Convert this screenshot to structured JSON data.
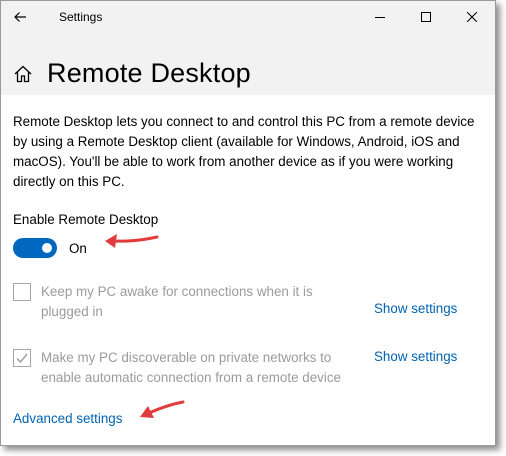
{
  "window": {
    "title": "Settings"
  },
  "header": {
    "page_title": "Remote Desktop"
  },
  "main": {
    "description": "Remote Desktop lets you connect to and control this PC from a remote device by using a Remote Desktop client (available for Windows, Android, iOS and macOS). You'll be able to work from another device as if you were working directly on this PC.",
    "enable_label": "Enable Remote Desktop",
    "toggle_state": "On",
    "option1": {
      "label": "Keep my PC awake for connections when it is plugged in",
      "checked": false,
      "link": "Show settings"
    },
    "option2": {
      "label": "Make my PC discoverable on private networks to enable automatic connection from a remote device",
      "checked": true,
      "link": "Show settings"
    },
    "advanced_link": "Advanced settings"
  },
  "colors": {
    "accent": "#0067c0",
    "link": "#0063b1",
    "annotation_arrow": "#e03c3c",
    "disabled_text": "#9b9b9b"
  },
  "icons": [
    "back-arrow-icon",
    "minimize-icon",
    "maximize-icon",
    "close-icon",
    "home-icon",
    "checkmark-icon",
    "annotation-arrow-icon"
  ]
}
